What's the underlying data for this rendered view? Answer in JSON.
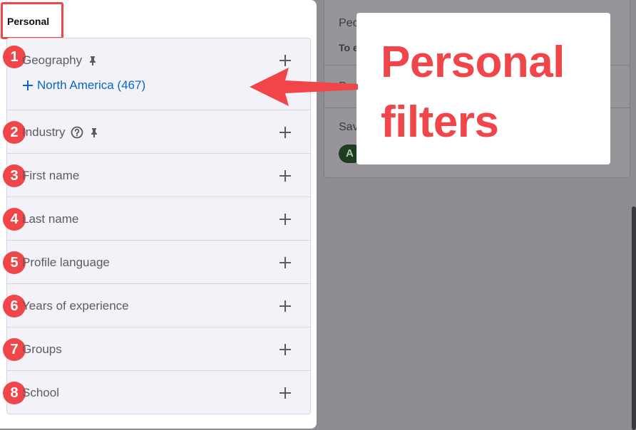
{
  "header": {
    "title": "Personal"
  },
  "filters": [
    {
      "number": "1",
      "label": "Geography",
      "pinned": true,
      "help": false
    },
    {
      "number": "2",
      "label": "Industry",
      "pinned": true,
      "help": true
    },
    {
      "number": "3",
      "label": "First name"
    },
    {
      "number": "4",
      "label": "Last name"
    },
    {
      "number": "5",
      "label": "Profile language"
    },
    {
      "number": "6",
      "label": "Years of experience"
    },
    {
      "number": "7",
      "label": "Groups"
    },
    {
      "number": "8",
      "label": "School"
    }
  ],
  "geography_suggestion": {
    "label": "North America (467)"
  },
  "background_panel": {
    "row1": "Peo",
    "row1_sub": "To e",
    "row2": "Peo",
    "row3": "Sav",
    "pill": "A"
  },
  "callout": {
    "text": "Personal\nfilters"
  },
  "colors": {
    "accent": "#f0464a",
    "link": "#0a66c2"
  }
}
